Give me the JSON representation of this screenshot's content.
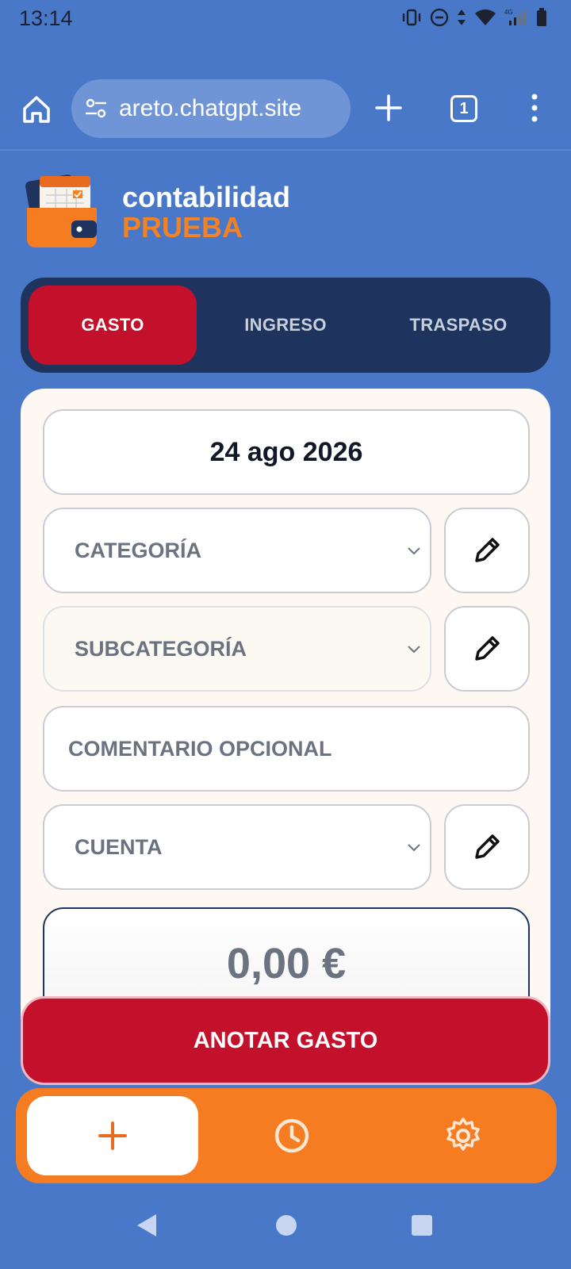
{
  "status": {
    "time": "13:14",
    "network": "4G"
  },
  "browser": {
    "url": "areto.chatgpt.site",
    "tab_count": "1"
  },
  "app": {
    "title": "contabilidad",
    "subtitle": "PRUEBA"
  },
  "tabs": [
    {
      "label": "GASTO",
      "active": true
    },
    {
      "label": "INGRESO",
      "active": false
    },
    {
      "label": "TRASPASO",
      "active": false
    }
  ],
  "form": {
    "date": "24 ago 2026",
    "category_placeholder": "CATEGORÍA",
    "subcategory_placeholder": "SUBCATEGORÍA",
    "comment_placeholder": "COMENTARIO OPCIONAL",
    "account_placeholder": "CUENTA",
    "amount": "0,00 €"
  },
  "submit_label": "ANOTAR GASTO",
  "bottom_nav": [
    {
      "icon": "plus-icon",
      "active": true
    },
    {
      "icon": "clock-icon",
      "active": false
    },
    {
      "icon": "gear-icon",
      "active": false
    }
  ],
  "colors": {
    "background": "#4a78c8",
    "primary_red": "#c3102b",
    "accent_orange": "#f57c20",
    "navy": "#1e345e"
  }
}
